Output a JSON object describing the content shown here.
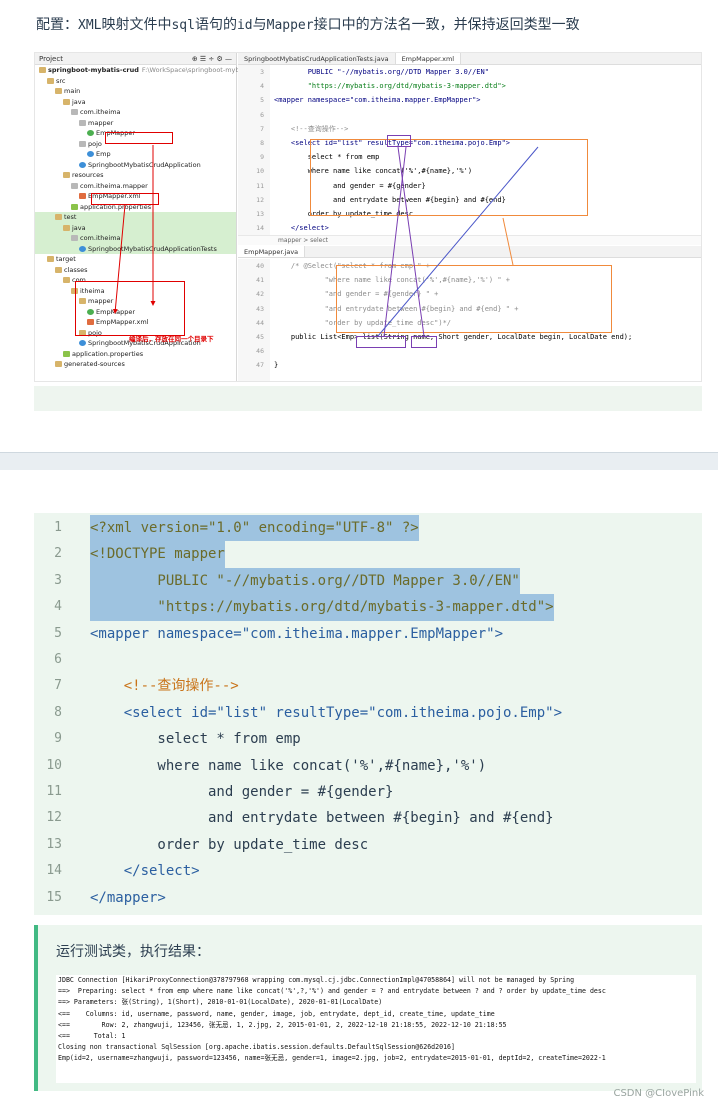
{
  "heading": {
    "prefix": "配置：",
    "xml": "XML",
    "part1": "映射文件中",
    "sql": "sql",
    "part2": "语句的",
    "id": "id",
    "part3": "与",
    "mapper": "Mapper",
    "part4": "接口中的方法名一致，并保持返回类型一致"
  },
  "ide": {
    "project_header": "Project",
    "tree": [
      {
        "label": "springboot-mybatis-crud",
        "suffix": "F:\\WorkSpace\\springboot-myb",
        "icon": "folder",
        "indent": 0
      },
      {
        "label": "src",
        "icon": "folder",
        "indent": 1
      },
      {
        "label": "main",
        "icon": "folder",
        "indent": 2
      },
      {
        "label": "java",
        "icon": "folder",
        "indent": 3
      },
      {
        "label": "com.itheima",
        "icon": "pkg",
        "indent": 4
      },
      {
        "label": "mapper",
        "icon": "pkg",
        "indent": 5
      },
      {
        "label": "EmpMapper",
        "icon": "intf",
        "indent": 6
      },
      {
        "label": "pojo",
        "icon": "pkg",
        "indent": 5
      },
      {
        "label": "Emp",
        "icon": "cls",
        "indent": 6
      },
      {
        "label": "SpringbootMybatisCrudApplication",
        "icon": "cls",
        "indent": 5
      },
      {
        "label": "resources",
        "icon": "folder",
        "indent": 3
      },
      {
        "label": "com.itheima.mapper",
        "icon": "pkg",
        "indent": 4
      },
      {
        "label": "EmpMapper.xml",
        "icon": "xml",
        "indent": 5
      },
      {
        "label": "application.properties",
        "icon": "prop",
        "indent": 4
      },
      {
        "label": "test",
        "icon": "folder",
        "indent": 2
      },
      {
        "label": "java",
        "icon": "folder",
        "indent": 3
      },
      {
        "label": "com.itheima",
        "icon": "pkg",
        "indent": 4
      },
      {
        "label": "SpringbootMybatisCrudApplicationTests",
        "icon": "cls",
        "indent": 5
      },
      {
        "label": "target",
        "icon": "folder",
        "indent": 1
      },
      {
        "label": "classes",
        "icon": "folder",
        "indent": 2
      },
      {
        "label": "com",
        "icon": "folder",
        "indent": 3
      },
      {
        "label": "itheima",
        "icon": "folder",
        "indent": 4
      },
      {
        "label": "mapper",
        "icon": "folder",
        "indent": 5
      },
      {
        "label": "EmpMapper",
        "icon": "intf",
        "indent": 6
      },
      {
        "label": "EmpMapper.xml",
        "icon": "xml",
        "indent": 6
      },
      {
        "label": "pojo",
        "icon": "folder",
        "indent": 5
      },
      {
        "label": "SpringbootMybatisCrudApplication",
        "icon": "cls",
        "indent": 5
      },
      {
        "label": "application.properties",
        "icon": "prop",
        "indent": 3
      },
      {
        "label": "generated-sources",
        "icon": "folder",
        "indent": 2
      }
    ],
    "red_note": "编译后，存放在同一个目录下",
    "tabs": [
      "SpringbootMybatisCrudApplicationTests.java",
      "EmpMapper.xml"
    ],
    "xml_gutter": [
      "3",
      "4",
      "5",
      "6",
      "7",
      "8",
      "9",
      "10",
      "11",
      "12",
      "13",
      "14"
    ],
    "xml_lines": [
      "        PUBLIC \"-//mybatis.org//DTD Mapper 3.0//EN\"",
      "        \"https://mybatis.org/dtd/mybatis-3-mapper.dtd\">",
      "<mapper namespace=\"com.itheima.mapper.EmpMapper\">",
      "",
      "    <!--查询操作-->",
      "    <select id=\"list\" resultType=\"com.itheima.pojo.Emp\">",
      "        select * from emp",
      "        where name like concat('%',#{name},'%')",
      "              and gender = #{gender}",
      "              and entrydate between #{begin} and #{end}",
      "        order by update_time desc",
      "    </select>"
    ],
    "breadcrumb": "mapper  >  select",
    "java_tab": "EmpMapper.java",
    "java_gutter": [
      "40",
      "41",
      "42",
      "43",
      "44",
      "45",
      "46",
      "47"
    ],
    "java_lines": [
      "    /* @Select(\"select * from emp \" +",
      "            \"where name like concat('%',#{name},'%') \" +",
      "            \"and gender = #{gender} \" +",
      "            \"and entrydate between #{begin} and #{end} \" +",
      "            \"order by update_time desc\")*/",
      "    public List<Emp> list(String name, Short gender, LocalDate begin, LocalDate end);",
      "",
      "}"
    ]
  },
  "codeblock": {
    "lines": [
      {
        "n": "1",
        "t": "<?xml version=\"1.0\" encoding=\"UTF-8\" ?>",
        "sel": true
      },
      {
        "n": "2",
        "t": "<!DOCTYPE mapper",
        "sel": true
      },
      {
        "n": "3",
        "t": "        PUBLIC \"-//mybatis.org//DTD Mapper 3.0//EN\"",
        "sel": true
      },
      {
        "n": "4",
        "t": "        \"https://mybatis.org/dtd/mybatis-3-mapper.dtd\">",
        "sel": true
      },
      {
        "n": "5",
        "t": "<mapper namespace=\"com.itheima.mapper.EmpMapper\">",
        "sel": false
      },
      {
        "n": "6",
        "t": "",
        "sel": false
      },
      {
        "n": "7",
        "t": "    <!--查询操作-->",
        "sel": false
      },
      {
        "n": "8",
        "t": "    <select id=\"list\" resultType=\"com.itheima.pojo.Emp\">",
        "sel": false
      },
      {
        "n": "9",
        "t": "        select * from emp",
        "sel": false
      },
      {
        "n": "10",
        "t": "        where name like concat('%',#{name},'%')",
        "sel": false
      },
      {
        "n": "11",
        "t": "              and gender = #{gender}",
        "sel": false
      },
      {
        "n": "12",
        "t": "              and entrydate between #{begin} and #{end}",
        "sel": false
      },
      {
        "n": "13",
        "t": "        order by update_time desc",
        "sel": false
      },
      {
        "n": "14",
        "t": "    </select>",
        "sel": false
      },
      {
        "n": "15",
        "t": "</mapper>",
        "sel": false
      }
    ]
  },
  "result": {
    "title": "运行测试类，执行结果：",
    "console": [
      "JDBC Connection [HikariProxyConnection@378797968 wrapping com.mysql.cj.jdbc.ConnectionImpl@47058864] will not be managed by Spring",
      "==>  Preparing: select * from emp where name like concat('%',?,'%') and gender = ? and entrydate between ? and ? order by update_time desc",
      "==> Parameters: 张(String), 1(Short), 2010-01-01(LocalDate), 2020-01-01(LocalDate)",
      "<==    Columns: id, username, password, name, gender, image, job, entrydate, dept_id, create_time, update_time",
      "<==        Row: 2, zhangwuji, 123456, 张无忌, 1, 2.jpg, 2, 2015-01-01, 2, 2022-12-10 21:18:55, 2022-12-10 21:18:55",
      "<==      Total: 1",
      "Closing non transactional SqlSession [org.apache.ibatis.session.defaults.DefaultSqlSession@626d2016]",
      "Emp(id=2, username=zhangwuji, password=123456, name=张无忌, gender=1, image=2.jpg, job=2, entrydate=2015-01-01, deptId=2, createTime=2022-1"
    ]
  },
  "watermark": "CSDN @CIovePink"
}
